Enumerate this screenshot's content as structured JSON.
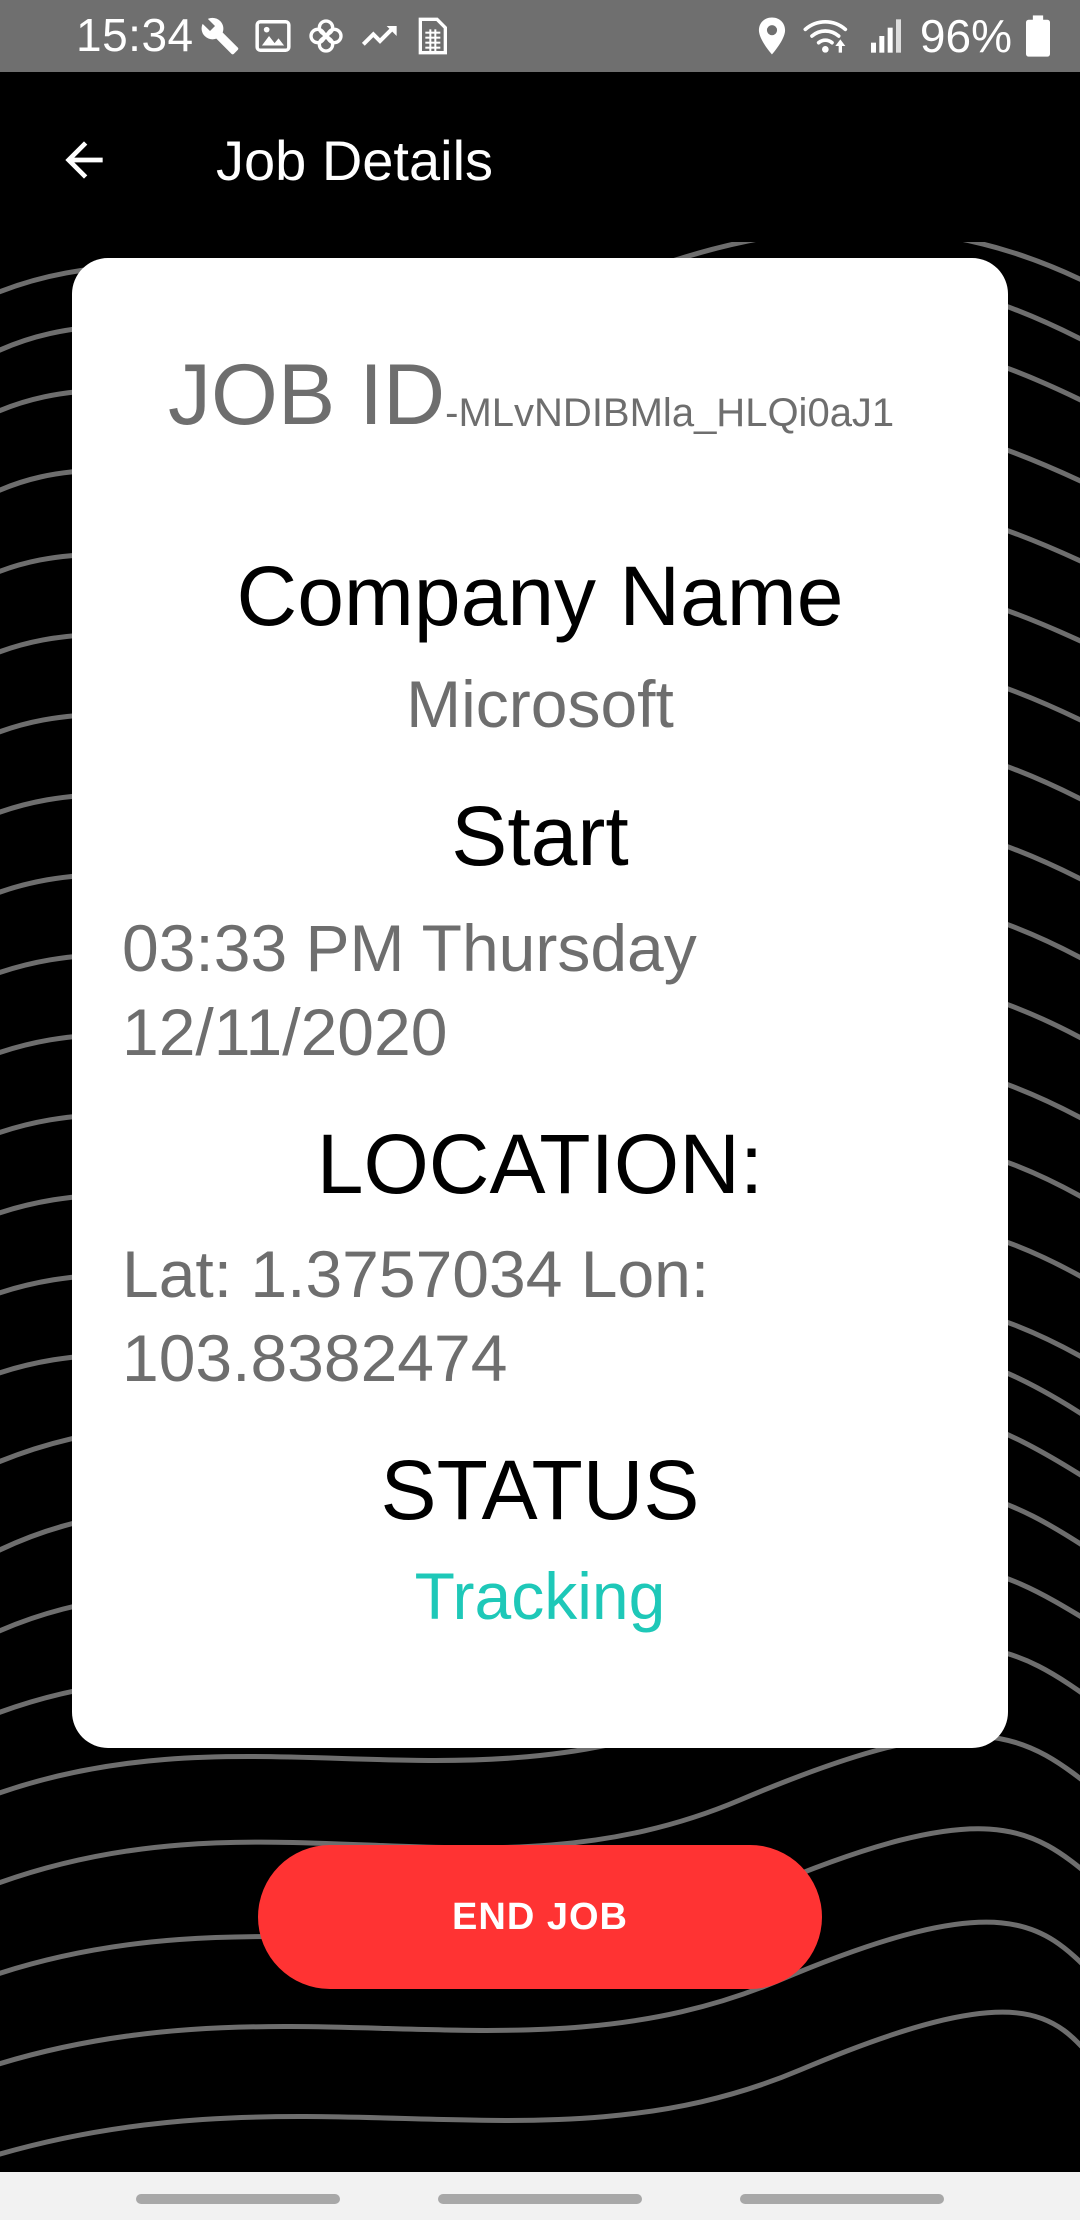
{
  "status_bar": {
    "time": "15:34",
    "battery": "96%",
    "icons_left": [
      "wrench-icon",
      "image-icon",
      "pinwheel-icon",
      "trending-icon",
      "data-saver-icon"
    ],
    "icons_right": [
      "location-icon",
      "wifi-icon",
      "signal-icon",
      "battery-icon"
    ]
  },
  "app_bar": {
    "title": "Job Details",
    "back_icon": "arrow-left-icon"
  },
  "job": {
    "id_label": "JOB ID",
    "id_value": "-MLvNDIBMla_HLQi0aJ1",
    "company_heading": "Company Name",
    "company_value": "Microsoft",
    "start_heading": "Start",
    "start_line1": "03:33 PM Thursday",
    "start_line2": "12/11/2020",
    "location_heading": "LOCATION:",
    "location_line1": "Lat: 1.3757034 Lon:",
    "location_line2": "103.8382474",
    "status_heading": "STATUS",
    "status_value": "Tracking"
  },
  "actions": {
    "end_job_label": "END JOB"
  },
  "colors": {
    "accent_red": "#ff3333",
    "status_teal": "#1ec8b8",
    "muted_text": "#6e6e6e",
    "background": "#000000",
    "card": "#ffffff"
  }
}
